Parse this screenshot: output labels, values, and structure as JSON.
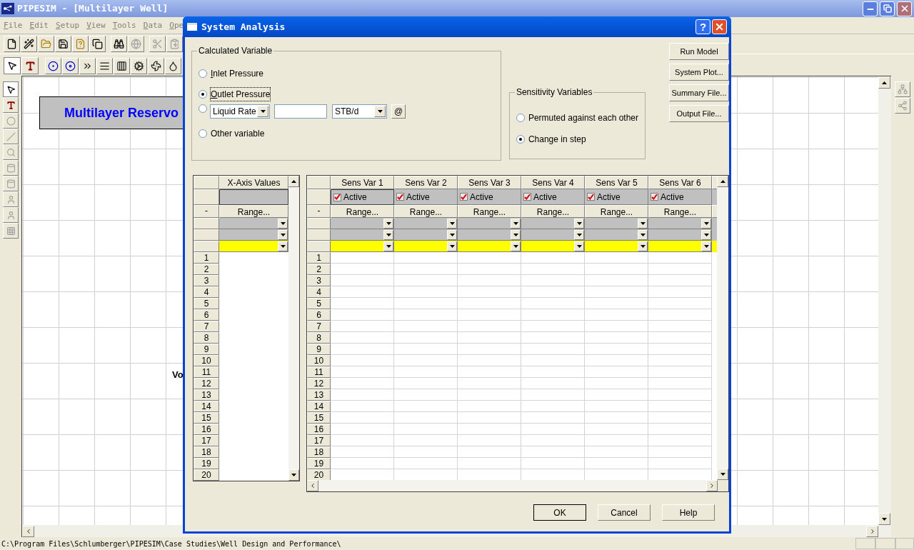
{
  "window": {
    "title": "PIPESIM - [Multilayer Well]"
  },
  "menu": [
    "File",
    "Edit",
    "Setup",
    "View",
    "Tools",
    "Data",
    "Ope"
  ],
  "toolbar": [
    {
      "kind": "new",
      "disabled": false
    },
    {
      "kind": "wand",
      "disabled": false
    },
    {
      "kind": "open",
      "disabled": false
    },
    {
      "kind": "save",
      "disabled": false
    },
    {
      "kind": "help",
      "disabled": false
    },
    {
      "kind": "saveall",
      "disabled": false
    },
    {
      "kind": "find",
      "disabled": false
    },
    {
      "kind": "globe",
      "disabled": true
    },
    {
      "kind": "cut",
      "disabled": true
    },
    {
      "kind": "copy",
      "disabled": true
    }
  ],
  "palette": [
    {
      "kind": "pointer",
      "selected": true,
      "disabled": false
    },
    {
      "kind": "text",
      "selected": false,
      "disabled": false
    },
    {
      "kind": "node",
      "selected": false,
      "disabled": true
    },
    {
      "kind": "link",
      "selected": false,
      "disabled": true
    },
    {
      "kind": "zoom",
      "selected": false,
      "disabled": true
    },
    {
      "kind": "well",
      "selected": false,
      "disabled": true
    },
    {
      "kind": "well",
      "selected": false,
      "disabled": true
    },
    {
      "kind": "figure",
      "selected": false,
      "disabled": true
    },
    {
      "kind": "figure",
      "selected": false,
      "disabled": true
    },
    {
      "kind": "grid",
      "selected": false,
      "disabled": true
    }
  ],
  "canvas": {
    "title_label": "Multilayer Reservo",
    "text_fragment": "Vo"
  },
  "dialog": {
    "title": "System Analysis",
    "help_glyph": "?",
    "calculated_variable": {
      "legend": "Calculated Variable",
      "options": [
        {
          "label": "Inlet Pressure",
          "selected": false
        },
        {
          "label": "Outlet Pressure",
          "selected": true
        },
        {
          "kind": "combo",
          "selected": false,
          "variable": "Liquid Rate",
          "unit": "STB/d",
          "at_button": "@"
        },
        {
          "label": "Other variable",
          "selected": false
        }
      ]
    },
    "sensitivity": {
      "legend": "Sensitivity Variables",
      "options": [
        {
          "label": "Permuted against each other",
          "selected": false
        },
        {
          "label": "Change in step",
          "selected": true
        }
      ]
    },
    "side_buttons": [
      "Run Model",
      "System Plot...",
      "Summary File...",
      "Output File..."
    ],
    "x_grid": {
      "header": "X-Axis Values",
      "range_marker": "-",
      "range_button": "Range...",
      "dropdown_rows": [
        {
          "highlighted": false
        },
        {
          "highlighted": false
        },
        {
          "highlighted": true
        }
      ],
      "rows": [
        "1",
        "2",
        "3",
        "4",
        "5",
        "6",
        "7",
        "8",
        "9",
        "10",
        "11",
        "12",
        "13",
        "14",
        "15",
        "16",
        "17",
        "18",
        "19",
        "20"
      ]
    },
    "sens_grid": {
      "range_marker": "-",
      "columns": [
        {
          "name": "Sens Var 1",
          "active_label": "Active",
          "active": true,
          "range_button": "Range..."
        },
        {
          "name": "Sens Var 2",
          "active_label": "Active",
          "active": true,
          "range_button": "Range..."
        },
        {
          "name": "Sens Var 3",
          "active_label": "Active",
          "active": true,
          "range_button": "Range..."
        },
        {
          "name": "Sens Var 4",
          "active_label": "Active",
          "active": true,
          "range_button": "Range..."
        },
        {
          "name": "Sens Var 5",
          "active_label": "Active",
          "active": true,
          "range_button": "Range..."
        },
        {
          "name": "Sens Var 6",
          "active_label": "Active",
          "active": true,
          "range_button": "Range..."
        }
      ],
      "dropdown_rows": [
        {
          "highlighted": false
        },
        {
          "highlighted": false
        },
        {
          "highlighted": true
        }
      ],
      "rows": [
        "1",
        "2",
        "3",
        "4",
        "5",
        "6",
        "7",
        "8",
        "9",
        "10",
        "11",
        "12",
        "13",
        "14",
        "15",
        "16",
        "17",
        "18",
        "19",
        "20"
      ]
    },
    "buttons": [
      "OK",
      "Cancel",
      "Help"
    ]
  },
  "status_bar": {
    "path": "C:\\Program Files\\Schlumberger\\PIPESIM\\Case Studies\\Well Design and Performance\\"
  }
}
